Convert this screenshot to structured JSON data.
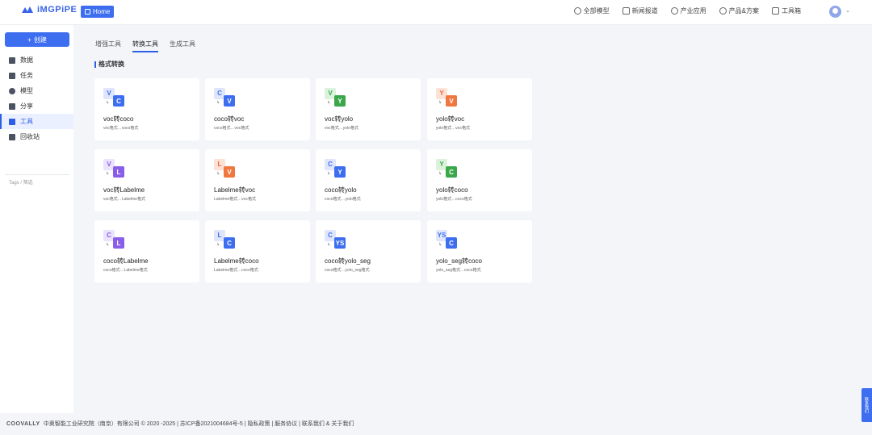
{
  "brand": {
    "logo_text": "iMGPiPE"
  },
  "header": {
    "home_label": "Home",
    "nav": [
      {
        "label": "全部模型",
        "icon": "cube-icon"
      },
      {
        "label": "新闻报道",
        "icon": "news-icon"
      },
      {
        "label": "产业应用",
        "icon": "gear-icon"
      },
      {
        "label": "产品&方案",
        "icon": "shield-icon"
      },
      {
        "label": "工具箱",
        "icon": "toolbox-icon"
      }
    ]
  },
  "sidebar": {
    "create_label": "创建",
    "items": [
      {
        "label": "数据",
        "icon": "data-icon"
      },
      {
        "label": "任务",
        "icon": "task-icon"
      },
      {
        "label": "模型",
        "icon": "model-icon"
      },
      {
        "label": "分享",
        "icon": "share-icon"
      },
      {
        "label": "工具",
        "icon": "tool-icon",
        "active": true
      },
      {
        "label": "回收站",
        "icon": "trash-icon"
      }
    ],
    "tags": "Tags / 筛选"
  },
  "tabs": [
    "增强工具",
    "转换工具",
    "生成工具"
  ],
  "section_title": "格式转换",
  "cards": [
    {
      "title": "voc转coco",
      "desc": "voc格式…coco格式",
      "back": "V",
      "front": "C",
      "back_color": "#dfe6fb",
      "back_text": "#3d6ef0",
      "front_color": "#3d6ef0"
    },
    {
      "title": "coco转voc",
      "desc": "coco格式…voc格式",
      "back": "C",
      "front": "V",
      "back_color": "#dfe6fb",
      "back_text": "#3d6ef0",
      "front_color": "#3d6ef0"
    },
    {
      "title": "voc转yolo",
      "desc": "voc格式…yolo格式",
      "back": "V",
      "front": "Y",
      "back_color": "#dcf2dc",
      "back_text": "#3aa84a",
      "front_color": "#3aa84a"
    },
    {
      "title": "yolo转voc",
      "desc": "yolo格式…voc格式",
      "back": "Y",
      "front": "V",
      "back_color": "#fbe1d6",
      "back_text": "#e9683a",
      "front_color": "#f07840"
    },
    {
      "title": "voc转Labelme",
      "desc": "voc格式…Labelme格式",
      "back": "V",
      "front": "L",
      "back_color": "#ebe2fb",
      "back_text": "#8a5ee9",
      "front_color": "#8a5ee9"
    },
    {
      "title": "Labelme转voc",
      "desc": "Labelme格式…voc格式",
      "back": "L",
      "front": "V",
      "back_color": "#fbe1d6",
      "back_text": "#e9683a",
      "front_color": "#f07840"
    },
    {
      "title": "coco转yolo",
      "desc": "coco格式…yolo格式",
      "back": "C",
      "front": "Y",
      "back_color": "#dfe6fb",
      "back_text": "#3d6ef0",
      "front_color": "#3d6ef0"
    },
    {
      "title": "yolo转coco",
      "desc": "yolo格式…coco格式",
      "back": "Y",
      "front": "C",
      "back_color": "#dcf2dc",
      "back_text": "#3aa84a",
      "front_color": "#3aa84a"
    },
    {
      "title": "coco转Labelme",
      "desc": "coco格式…Labelme格式",
      "back": "C",
      "front": "L",
      "back_color": "#ebe2fb",
      "back_text": "#8a5ee9",
      "front_color": "#8a5ee9"
    },
    {
      "title": "Labelme转coco",
      "desc": "Labelme格式…coco格式",
      "back": "L",
      "front": "C",
      "back_color": "#dfe6fb",
      "back_text": "#3d6ef0",
      "front_color": "#3d6ef0"
    },
    {
      "title": "coco转yolo_seg",
      "desc": "coco格式…yolo_seg格式",
      "back": "C",
      "front": "YS",
      "back_color": "#dfe6fb",
      "back_text": "#3d6ef0",
      "front_color": "#3d6ef0"
    },
    {
      "title": "yolo_seg转coco",
      "desc": "yolo_seg格式…coco格式",
      "back": "YS",
      "front": "C",
      "back_color": "#dfe6fb",
      "back_text": "#3d6ef0",
      "front_color": "#3d6ef0"
    }
  ],
  "footer": {
    "brand": "COOVALLY",
    "text": "中奥智能工业研究院（南京）有限公司 © 2020 -2025 | 苏ICP备2021004684号-5 | 隐私政策 | 服务协议 | 联系我们 & 关于我们"
  },
  "float_button": "联系我们"
}
